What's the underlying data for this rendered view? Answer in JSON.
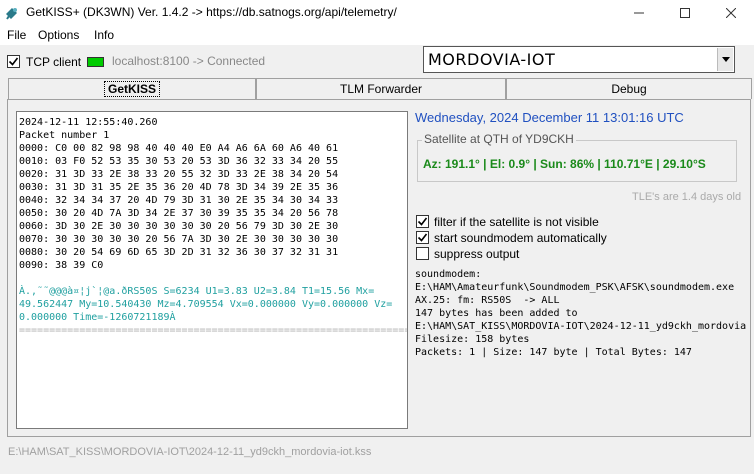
{
  "window": {
    "title": "GetKISS+ (DK3WN) Ver. 1.4.2 -> https://db.satnogs.org/api/telemetry/",
    "minimize_icon": "minimize-icon",
    "maximize_icon": "maximize-icon",
    "close_icon": "close-icon"
  },
  "menu": {
    "file": "File",
    "options": "Options",
    "info": "Info"
  },
  "connection": {
    "tcp_client_label": "TCP client",
    "tcp_client_checked": true,
    "status": "localhost:8100 -> Connected",
    "led_color": "#00cc00"
  },
  "satellite_select": {
    "value": "MORDOVIA-IOT"
  },
  "tabs": [
    {
      "label": "GetKISS",
      "active": true
    },
    {
      "label": "TLM Forwarder",
      "active": false
    },
    {
      "label": "Debug",
      "active": false
    }
  ],
  "log": {
    "timestamp": "2024-12-11 12:55:40.260",
    "packet_number": "Packet number 1",
    "hex_lines": [
      "0000: C0 00 82 98 98 40 40 40 E0 A4 A6 6A 60 A6 40 61",
      "0010: 03 F0 52 53 35 30 53 20 53 3D 36 32 33 34 20 55",
      "0020: 31 3D 33 2E 38 33 20 55 32 3D 33 2E 38 34 20 54",
      "0030: 31 3D 31 35 2E 35 36 20 4D 78 3D 34 39 2E 35 36",
      "0040: 32 34 34 37 20 4D 79 3D 31 30 2E 35 34 30 34 33",
      "0050: 30 20 4D 7A 3D 34 2E 37 30 39 35 35 34 20 56 78",
      "0060: 3D 30 2E 30 30 30 30 30 30 20 56 79 3D 30 2E 30",
      "0070: 30 30 30 30 30 20 56 7A 3D 30 2E 30 30 30 30 30",
      "0080: 30 20 54 69 6D 65 3D 2D 31 32 36 30 37 32 31 31",
      "0090: 38 39 C0"
    ],
    "decoded_lines": [
      "À.,˜˜@@@à¤¦j`¦@a.ðRS50S S=6234 U1=3.83 U2=3.84 T1=15.56 Mx=",
      "49.562447 My=10.540430 Mz=4.709554 Vx=0.000000 Vy=0.000000 Vz=",
      "0.000000 Time=-1260721189À"
    ],
    "separator": "==================================================================="
  },
  "datetime": "Wednesday, 2024 December 11  13:01:16 UTC",
  "satellite_qth": {
    "legend": "Satellite at QTH of YD9CKH",
    "stats": "Az: 191.1° | El: 0.9° | Sun: 86% | 110.71°E | 29.10°S",
    "stats_color": "#1a8a1a"
  },
  "tle_age": "TLE's are 1.4 days old",
  "options": [
    {
      "label": "filter if the satellite is not visible",
      "checked": true
    },
    {
      "label": "start soundmodem automatically",
      "checked": true
    },
    {
      "label": "suppress output",
      "checked": false
    }
  ],
  "modem_log": [
    "soundmodem:",
    "E:\\HAM\\Amateurfunk\\Soundmodem_PSK\\AFSK\\soundmodem.exe",
    "AX.25: fm: RS50S  -> ALL",
    "147 bytes has been added to",
    "E:\\HAM\\SAT_KISS\\MORDOVIA-IOT\\2024-12-11_yd9ckh_mordovia",
    "Filesize: 158 bytes",
    "Packets: 1 | Size: 147 byte | Total Bytes: 147"
  ],
  "status_path": "E:\\HAM\\SAT_KISS\\MORDOVIA-IOT\\2024-12-11_yd9ckh_mordovia-iot.kss"
}
